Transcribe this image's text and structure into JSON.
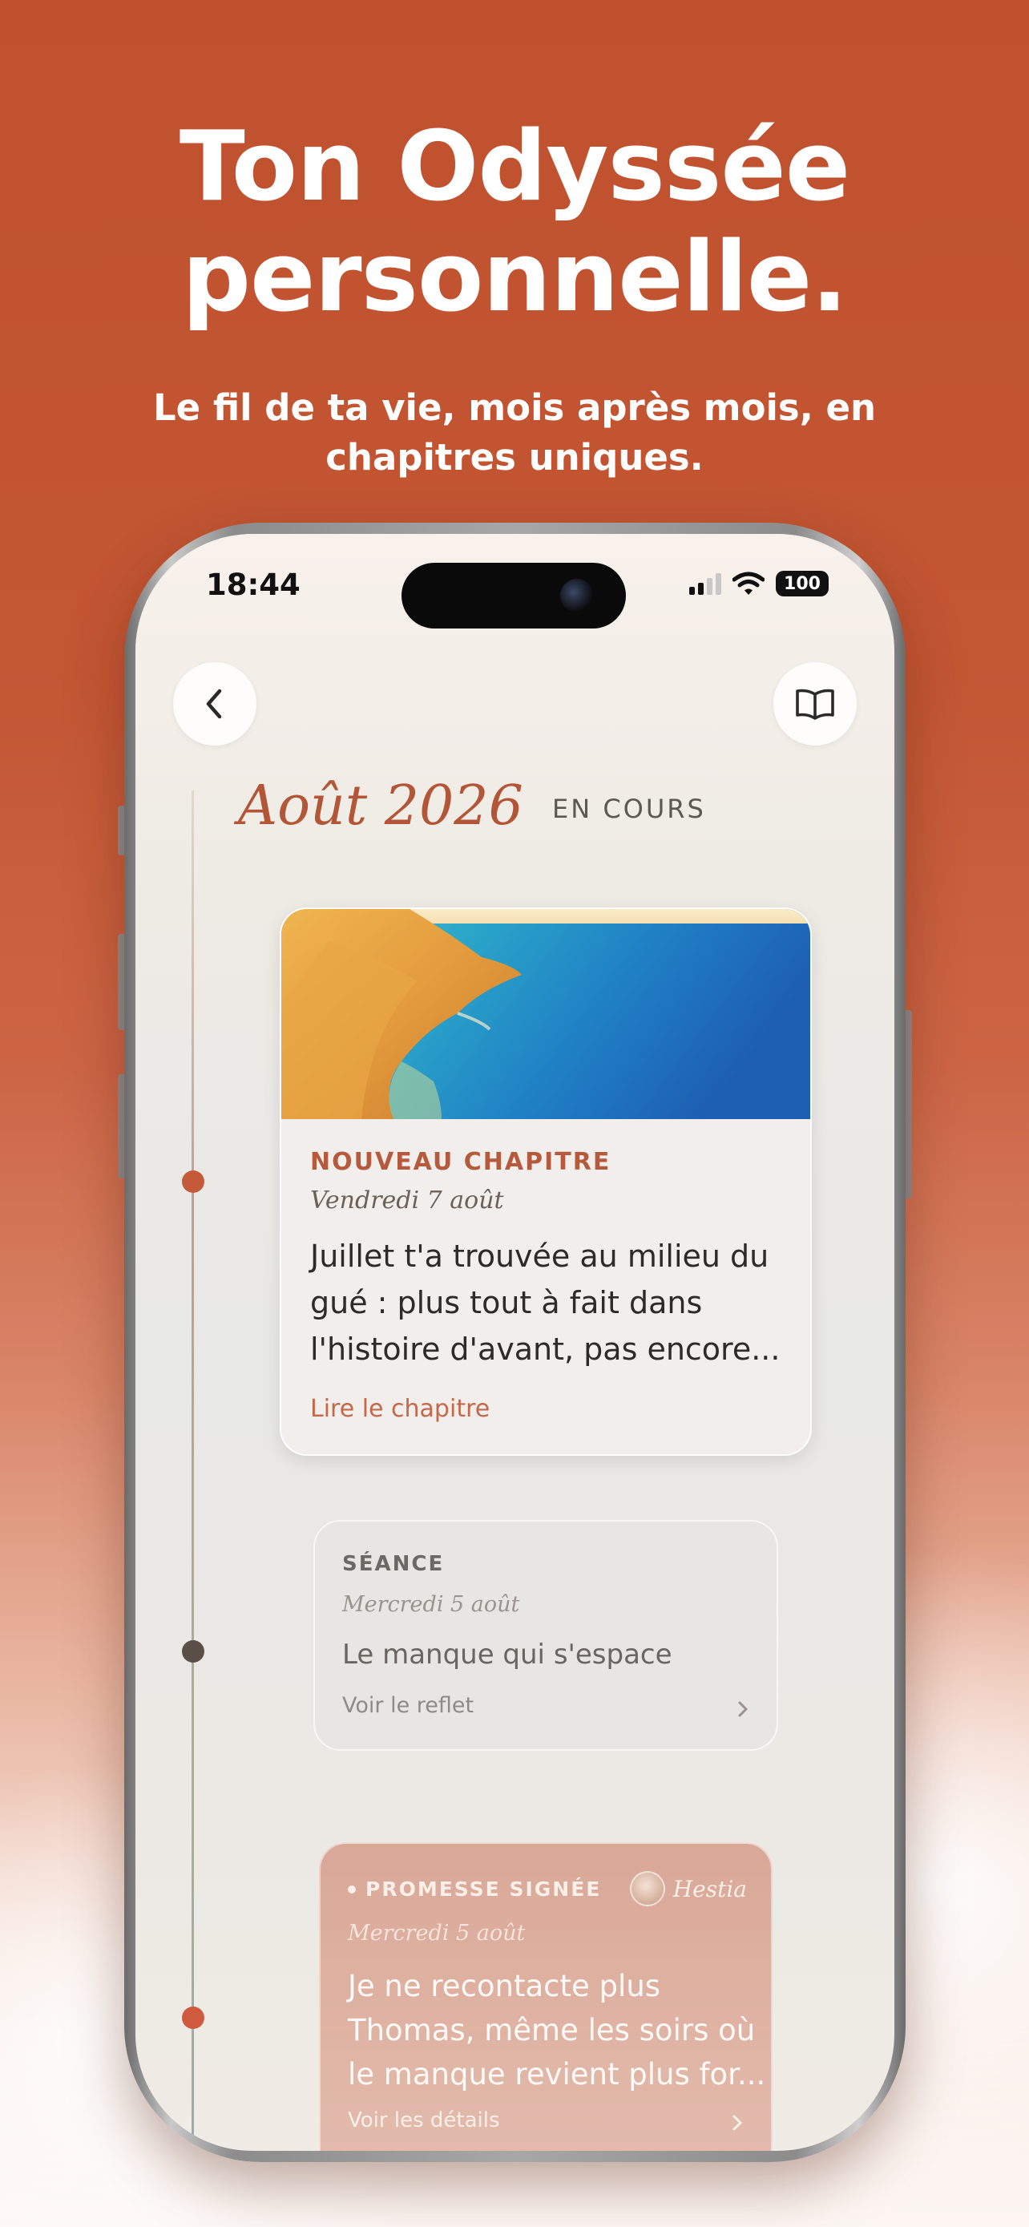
{
  "marketing": {
    "title_line1": "Ton Odyssée",
    "title_line2": "personnelle.",
    "subtitle_line1": "Le fil de ta vie, mois après mois, en",
    "subtitle_line2": "chapitres uniques."
  },
  "status_bar": {
    "time": "18:44",
    "battery": "100",
    "icons": [
      "signal-icon",
      "wifi-icon",
      "battery-icon"
    ]
  },
  "nav": {
    "back_icon": "chevron-left-icon",
    "book_icon": "book-open-icon"
  },
  "month_header": {
    "month": "Août 2026",
    "status": "EN COURS"
  },
  "entries": [
    {
      "kind": "chapter",
      "kicker": "NOUVEAU CHAPITRE",
      "date": "Vendredi 7 août",
      "text_lines": [
        "Juillet t'a trouvée au milieu du",
        "gué : plus tout à fait dans",
        "l'histoire d'avant, pas encore..."
      ],
      "link": "Lire le chapitre"
    },
    {
      "kind": "seance",
      "kicker": "SÉANCE",
      "date": "Mercredi 5 août",
      "title": "Le manque qui s'espace",
      "link": "Voir le reflet"
    },
    {
      "kind": "promise",
      "kicker": "PROMESSE SIGNÉE",
      "author": "Hestia",
      "date": "Mercredi 5 août",
      "text_lines": [
        "Je ne recontacte plus",
        "Thomas, même les soirs où",
        "le manque revient plus for..."
      ],
      "link": "Voir les détails"
    }
  ],
  "colors": {
    "accent": "#b65a3d",
    "background_top": "#bf512f",
    "timeline_dot_chapter": "#c55a3a",
    "timeline_dot_seance": "#5a4f47",
    "timeline_dot_promise": "#cf5a3d"
  }
}
